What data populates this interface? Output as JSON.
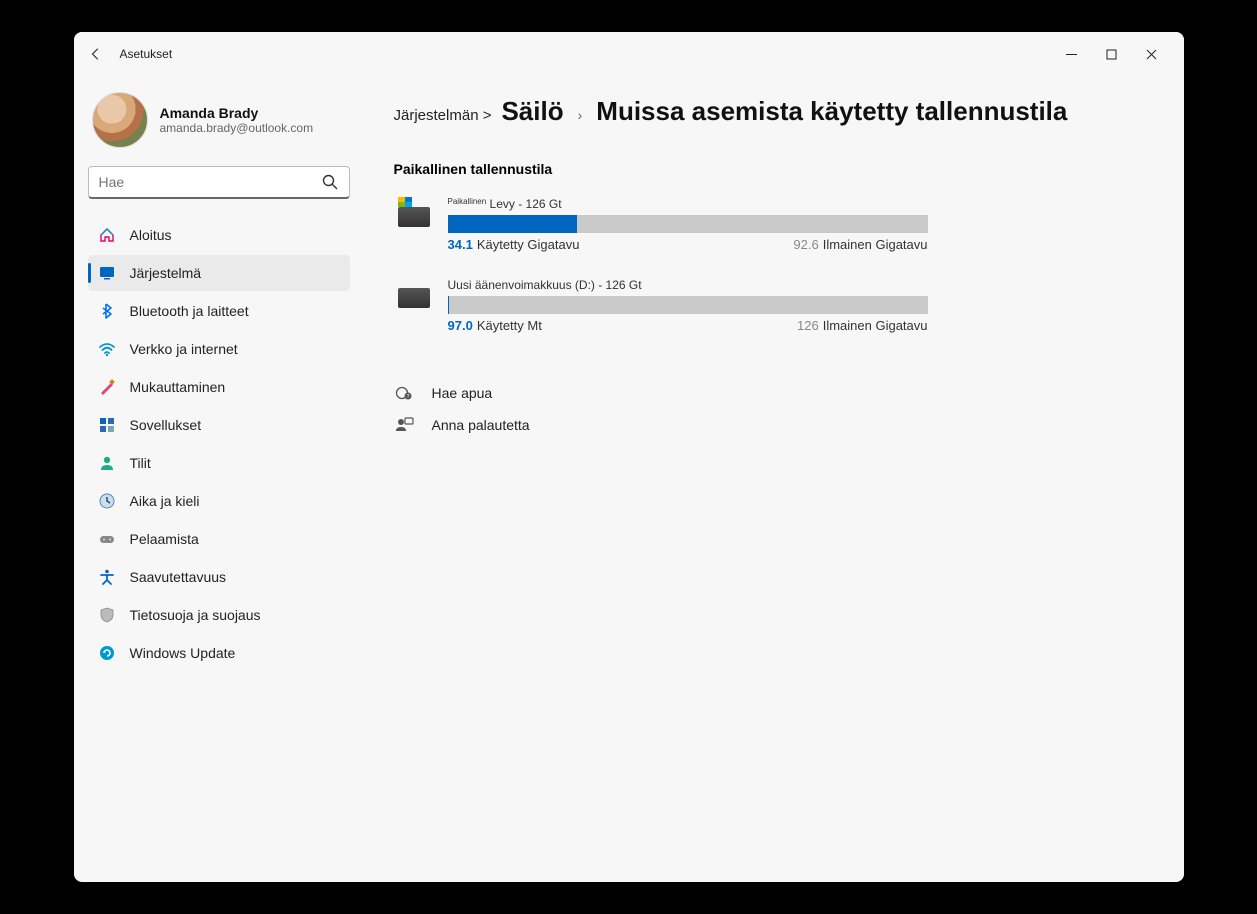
{
  "window": {
    "title": "Asetukset"
  },
  "profile": {
    "name": "Amanda Brady",
    "email": "amanda.brady@outlook.com"
  },
  "search": {
    "placeholder": "Hae"
  },
  "nav": {
    "items": [
      {
        "id": "home",
        "label": "Aloitus",
        "icon": "home-icon"
      },
      {
        "id": "system",
        "label": "Järjestelmä",
        "icon": "system-icon",
        "selected": true
      },
      {
        "id": "bluetooth",
        "label": "Bluetooth ja laitteet",
        "icon": "bluetooth-icon"
      },
      {
        "id": "network",
        "label": "Verkko ja internet",
        "icon": "wifi-icon"
      },
      {
        "id": "personalization",
        "label": "Mukauttaminen",
        "icon": "brush-icon"
      },
      {
        "id": "apps",
        "label": "Sovellukset",
        "icon": "apps-icon"
      },
      {
        "id": "accounts",
        "label": "Tilit",
        "icon": "person-icon"
      },
      {
        "id": "time",
        "label": "Aika ja kieli",
        "icon": "clock-icon"
      },
      {
        "id": "gaming",
        "label": "Pelaamista",
        "icon": "gamepad-icon"
      },
      {
        "id": "accessibility",
        "label": "Saavutettavuus",
        "icon": "accessibility-icon"
      },
      {
        "id": "privacy",
        "label": "Tietosuoja ja suojaus",
        "icon": "shield-icon"
      },
      {
        "id": "update",
        "label": "Windows Update",
        "icon": "update-icon"
      }
    ]
  },
  "breadcrumb": {
    "root": "Järjestelmän >",
    "parent": "Säilö",
    "title": "Muissa asemista käytetty tallennustila"
  },
  "section_title": "Paikallinen tallennustila",
  "drives": [
    {
      "tag": "Paikallinen",
      "name": "Levy - 126 Gt",
      "used_value": "34.1",
      "used_label": "Käytetty Gigatavu",
      "free_value": "92.6",
      "free_label": "Ilmainen Gigatavu",
      "used_pct": 27,
      "is_os": true
    },
    {
      "tag": "",
      "name": "Uusi äänenvoimakkuus (D:) - 126 Gt",
      "used_value": "97.0",
      "used_label": "Käytetty Mt",
      "free_value": "126",
      "free_label": "Ilmainen Gigatavu",
      "used_pct": 0.1,
      "is_os": false
    }
  ],
  "help": {
    "get_help": "Hae apua",
    "feedback": "Anna palautetta"
  }
}
